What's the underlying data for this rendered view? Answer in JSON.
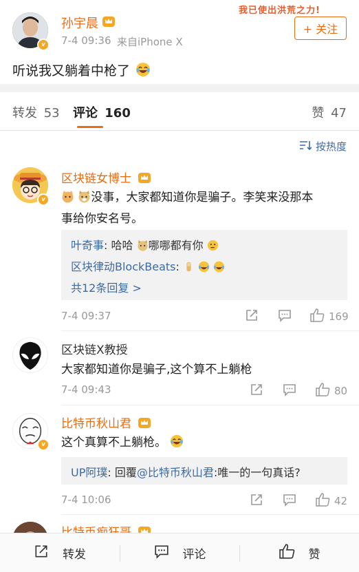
{
  "post": {
    "author": "孙宇晨",
    "time": "7-4 09:36",
    "source": "来自iPhone X",
    "follow_label": "+ 关注",
    "banner": "我已使出洪荒之力!",
    "content": "听说我又躺着中枪了"
  },
  "tabs": {
    "repost_label": "转发",
    "repost_count": "53",
    "comment_label": "评论",
    "comment_count": "160",
    "like_label": "赞",
    "like_count": "47"
  },
  "sort_label": "按热度",
  "comments": [
    {
      "author": "区块链女博士",
      "text_line1": "没事，大家都知道你是骗子。李笑来没那本",
      "text_line2": "事给你安名号。",
      "replies": [
        {
          "user": "叶奇事",
          "text": "哈哈",
          "text2": "哪哪都有你"
        },
        {
          "user": "区块律动BlockBeats",
          "text": ""
        }
      ],
      "more_replies": "共12条回复 >",
      "time": "7-4 09:37",
      "likes": "169"
    },
    {
      "author": "区块链X教授",
      "text_line1": "大家都知道你是骗子,这个算不上躺枪",
      "time": "7-4 09:43",
      "likes": "80"
    },
    {
      "author": "比特币秋山君",
      "text_line1": "这个真算不上躺枪。",
      "replies": [
        {
          "user": "UP阿璞",
          "prefix": "回覆",
          "mention": "@比特币秋山君",
          "text": ":唯一的一句真话?"
        }
      ],
      "time": "7-4 10:06",
      "likes": "42"
    },
    {
      "author": "比特币痴狂哥"
    }
  ],
  "bottom_bar": {
    "repost": "转发",
    "comment": "评论",
    "like": "赞"
  },
  "colors": {
    "orange": "#e86c11",
    "link_blue": "#3c6aa6",
    "gray_text": "#999999",
    "vip_gold": "#f5a623"
  }
}
